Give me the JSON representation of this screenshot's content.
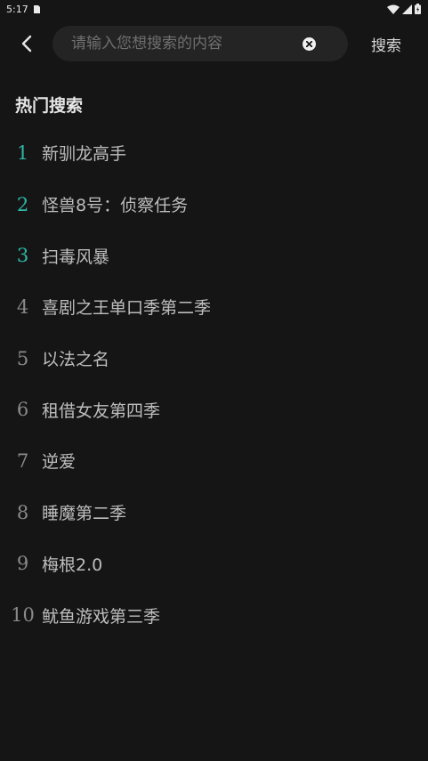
{
  "status": {
    "time": "5:17"
  },
  "search": {
    "placeholder": "请输入您想搜索的内容",
    "value": "",
    "button_label": "搜索"
  },
  "section": {
    "title": "热门搜索"
  },
  "hot_items": [
    {
      "rank": "1",
      "title": "新驯龙高手"
    },
    {
      "rank": "2",
      "title": "怪兽8号：侦察任务"
    },
    {
      "rank": "3",
      "title": "扫毒风暴"
    },
    {
      "rank": "4",
      "title": "喜剧之王单口季第二季"
    },
    {
      "rank": "5",
      "title": "以法之名"
    },
    {
      "rank": "6",
      "title": "租借女友第四季"
    },
    {
      "rank": "7",
      "title": "逆爱"
    },
    {
      "rank": "8",
      "title": "睡魔第二季"
    },
    {
      "rank": "9",
      "title": "梅根2.0"
    },
    {
      "rank": "10",
      "title": "鱿鱼游戏第三季"
    }
  ],
  "colors": {
    "background": "#151515",
    "search_bg": "#242424",
    "top_rank_accent": "#2fb6a6",
    "rank_default": "#8a8a8a"
  },
  "icons": {
    "back": "chevron-left-icon",
    "clear": "clear-icon",
    "wifi": "wifi-icon",
    "signal": "signal-icon",
    "battery": "battery-icon",
    "sd": "sd-card-icon"
  }
}
